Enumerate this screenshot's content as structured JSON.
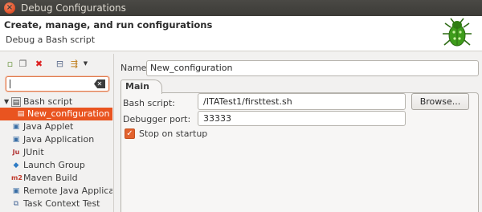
{
  "window": {
    "title": "Debug Configurations"
  },
  "header": {
    "title": "Create, manage, and run configurations",
    "subtitle": "Debug a Bash script"
  },
  "filter": {
    "value": ""
  },
  "tree": {
    "items": [
      {
        "label": "Bash script",
        "icon": "bash-script-icon",
        "expanded": true,
        "selected": false,
        "level": 0
      },
      {
        "label": "New_configuration",
        "icon": "bash-config-icon",
        "selected": true,
        "level": 1
      },
      {
        "label": "Java Applet",
        "icon": "java-applet-icon",
        "selected": false,
        "level": 0
      },
      {
        "label": "Java Application",
        "icon": "java-application-icon",
        "selected": false,
        "level": 0
      },
      {
        "label": "JUnit",
        "icon": "junit-icon",
        "selected": false,
        "level": 0
      },
      {
        "label": "Launch Group",
        "icon": "launch-group-icon",
        "selected": false,
        "level": 0
      },
      {
        "label": "Maven Build",
        "icon": "maven-icon",
        "selected": false,
        "level": 0
      },
      {
        "label": "Remote Java Application",
        "icon": "remote-java-icon",
        "selected": false,
        "level": 0
      },
      {
        "label": "Task Context Test",
        "icon": "task-context-icon",
        "selected": false,
        "level": 0
      }
    ]
  },
  "form": {
    "name_label": "Name:",
    "name_value": "New_configuration",
    "tab_main": "Main",
    "script_label": "Bash script:",
    "script_value": "/ITATest1/firsttest.sh",
    "browse_label": "Browse...",
    "port_label": "Debugger port:",
    "port_value": "33333",
    "stop_label": "Stop on startup",
    "stop_checked": true
  },
  "colors": {
    "accent": "#e95420",
    "titlebar": "#3c3b37"
  }
}
